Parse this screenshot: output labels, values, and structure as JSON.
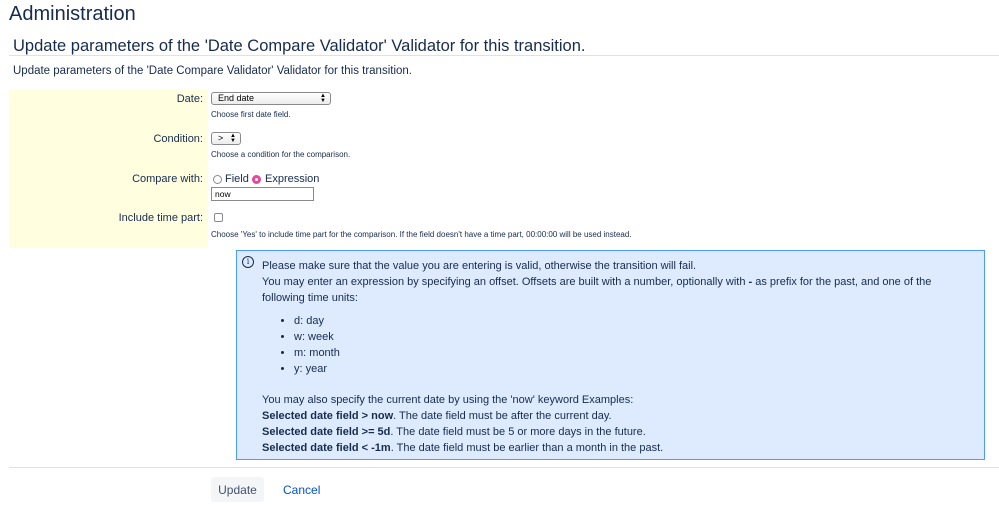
{
  "page": {
    "title": "Administration",
    "form_title": "Update parameters of the 'Date Compare Validator' Validator for this transition.",
    "form_description": "Update parameters of the 'Date Compare Validator' Validator for this transition."
  },
  "fields": {
    "date": {
      "label": "Date:",
      "value": "End date",
      "hint": "Choose first date field."
    },
    "condition": {
      "label": "Condition:",
      "value": ">",
      "hint": "Choose a condition for the comparison."
    },
    "compare_with": {
      "label": "Compare with:",
      "options": [
        {
          "label": "Field",
          "checked": false
        },
        {
          "label": "Expression",
          "checked": true
        }
      ],
      "expression_value": "now"
    },
    "include_time": {
      "label": "Include time part:",
      "checked": false,
      "hint": "Choose 'Yes' to include time part for the comparison. If the field doesn't have a time part, 00:00:00 will be used instead."
    }
  },
  "info": {
    "icon": "info-icon",
    "line1": "Please make sure that the value you are entering is valid, otherwise the transition will fail.",
    "line2_a": "You may enter an expression by specifying an offset. Offsets are built with a number, optionally with ",
    "line2_b": "-",
    "line2_c": " as prefix for the past, and one of the following time units:",
    "units": [
      "d: day",
      "w: week",
      "m: month",
      "y: year"
    ],
    "now_line": "You may also specify the current date by using the 'now' keyword Examples:",
    "examples": [
      {
        "bold": "Selected date field > now",
        "text": ". The date field must be after the current day."
      },
      {
        "bold": "Selected date field >= 5d",
        "text": ". The date field must be 5 or more days in the future."
      },
      {
        "bold": "Selected date field < -1m",
        "text": ". The date field must be earlier than a month in the past."
      }
    ]
  },
  "actions": {
    "update_label": "Update",
    "cancel_label": "Cancel"
  },
  "colors": {
    "field_area_bg": "#ffffe0",
    "info_bg": "#deebff",
    "info_border": "#4c9aff",
    "link": "#0052cc",
    "radio_selected": "#e8479a"
  }
}
